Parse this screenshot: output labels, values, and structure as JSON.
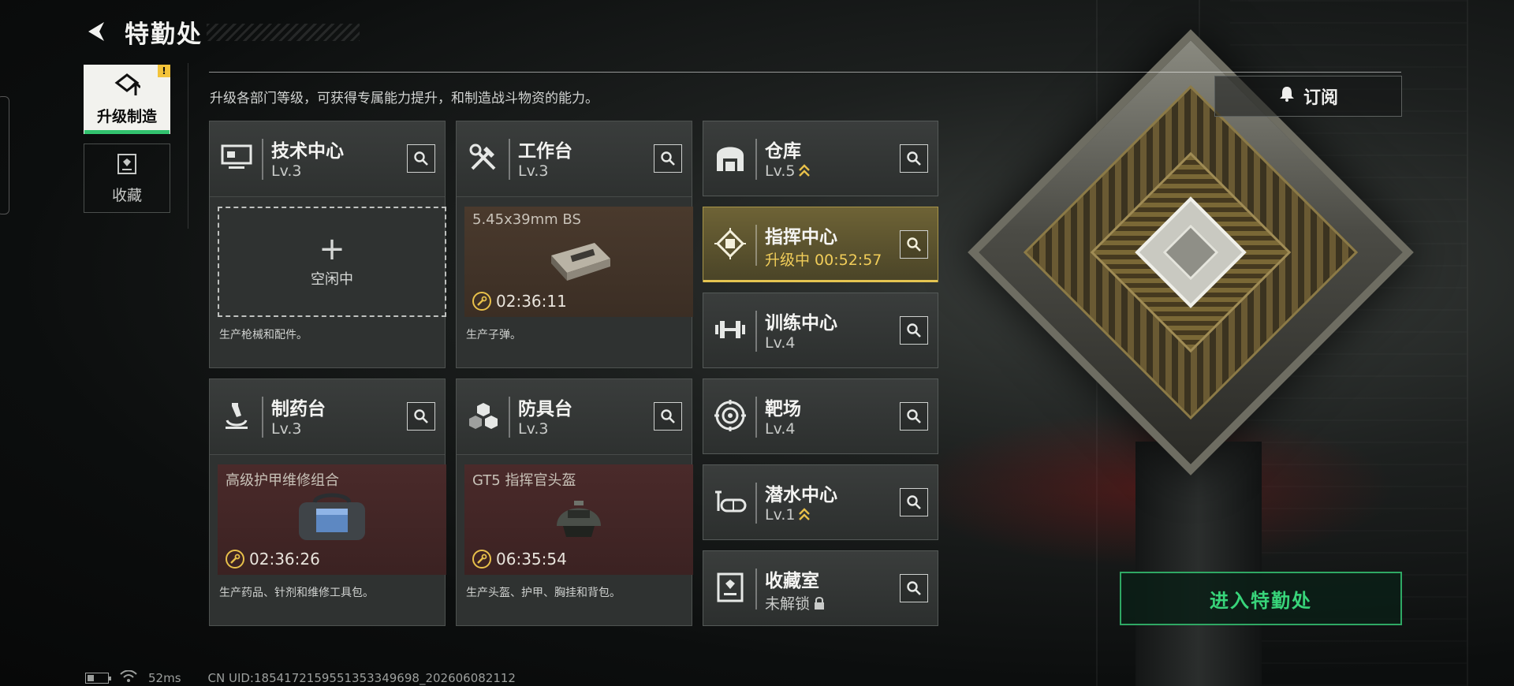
{
  "header": {
    "title": "特勤处"
  },
  "nav": {
    "items": [
      {
        "label": "升级制造",
        "badge": "!"
      },
      {
        "label": "收藏"
      }
    ]
  },
  "description": "升级各部门等级，可获得专属能力提升，和制造战斗物资的能力。",
  "subscribe_label": "订阅",
  "production": [
    {
      "name": "技术中心",
      "level": "Lv.3",
      "slot_state": "idle",
      "idle_label": "空闲中",
      "desc": "生产枪械和配件。"
    },
    {
      "name": "工作台",
      "level": "Lv.3",
      "slot_state": "busy",
      "item": "5.45x39mm BS",
      "timer": "02:36:11",
      "desc": "生产子弹。"
    },
    {
      "name": "制药台",
      "level": "Lv.3",
      "slot_state": "busy",
      "item": "高级护甲维修组合",
      "timer": "02:36:26",
      "desc": "生产药品、针剂和维修工具包。"
    },
    {
      "name": "防具台",
      "level": "Lv.3",
      "slot_state": "busy",
      "item": "GT5 指挥官头盔",
      "timer": "06:35:54",
      "desc": "生产头盔、护甲、胸挂和背包。"
    }
  ],
  "facilities": [
    {
      "name": "仓库",
      "level": "Lv.5",
      "upgradable": true
    },
    {
      "name": "指挥中心",
      "status": "升级中 00:52:57",
      "upgrading": true
    },
    {
      "name": "训练中心",
      "level": "Lv.4"
    },
    {
      "name": "靶场",
      "level": "Lv.4"
    },
    {
      "name": "潜水中心",
      "level": "Lv.1",
      "upgradable": true
    },
    {
      "name": "收藏室",
      "level": "未解锁",
      "locked": true
    }
  ],
  "enter_button": "进入特勤处",
  "status_bar": {
    "ping": "52ms",
    "uid": "CN UID:1854172159551353349698_202606082112"
  },
  "colors": {
    "accent_green": "#38d47a",
    "upgrade_gold": "#f1cd59",
    "badge_yellow": "#f3c33a"
  }
}
